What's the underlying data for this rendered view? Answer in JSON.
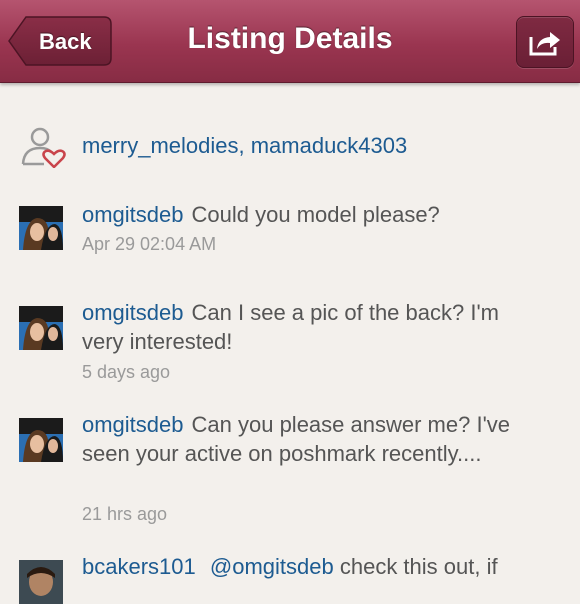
{
  "header": {
    "title": "Listing Details",
    "back_label": "Back"
  },
  "likes": {
    "users": "merry_melodies, mamaduck4303"
  },
  "comments": [
    {
      "user": "omgitsdeb",
      "text": "Could you model please?",
      "time": "Apr 29 02:04 AM"
    },
    {
      "user": "omgitsdeb",
      "text": "Can I see a pic of the back? I'm very interested!",
      "time": "5 days ago"
    },
    {
      "user": "omgitsdeb",
      "text": "Can you please answer me? I've seen your active on poshmark recently....",
      "time": "21 hrs ago"
    },
    {
      "user": "bcakers101",
      "mention": "@omgitsdeb",
      "text": "check this out, if",
      "time": ""
    }
  ],
  "colors": {
    "navbar": "#9a3550",
    "link": "#1d5b91",
    "background": "#f3f0ec"
  },
  "icons": {
    "back": "back-arrow-icon",
    "share": "share-icon",
    "likes": "person-heart-icon"
  }
}
